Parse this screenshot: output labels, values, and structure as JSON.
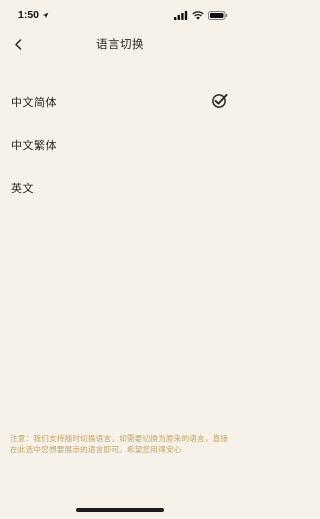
{
  "status_bar": {
    "time": "1:50",
    "location_icon": "location-arrow-icon",
    "signal_icon": "cellular-signal-icon",
    "wifi_icon": "wifi-icon",
    "battery_icon": "battery-icon"
  },
  "nav": {
    "back_icon": "chevron-left-icon",
    "title": "语言切换"
  },
  "languages": [
    {
      "label": "中文简体",
      "selected": true
    },
    {
      "label": "中文繁体",
      "selected": false
    },
    {
      "label": "英文",
      "selected": false
    }
  ],
  "notice": "注意：我们支持随时切换语言，如需要切换为原来的语言，直接在此选中您想要展示的语言即可。希望您用得安心",
  "colors": {
    "background": "#f6f2e9",
    "notice_text": "#c3a462",
    "primary_text": "#2b2620"
  }
}
